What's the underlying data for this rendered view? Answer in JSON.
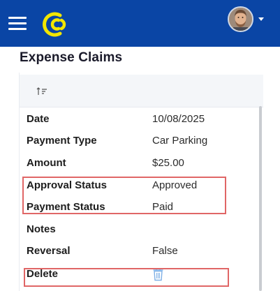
{
  "header": {
    "menu_icon": "hamburger-menu-icon",
    "logo_icon": "company-logo-icon",
    "avatar_icon": "user-avatar",
    "accent_color": "#0a45a5",
    "logo_color": "#f2e600"
  },
  "page": {
    "title": "Expense Claims"
  },
  "toolbar": {
    "sort_icon": "sort-ascending-icon"
  },
  "details": {
    "date": {
      "label": "Date",
      "value": "10/08/2025"
    },
    "payment_type": {
      "label": "Payment Type",
      "value": "Car Parking"
    },
    "amount": {
      "label": "Amount",
      "value": "$25.00"
    },
    "approval_status": {
      "label": "Approval Status",
      "value": "Approved"
    },
    "payment_status": {
      "label": "Payment Status",
      "value": "Paid"
    },
    "notes": {
      "label": "Notes",
      "value": ""
    },
    "reversal": {
      "label": "Reversal",
      "value": "False"
    },
    "delete": {
      "label": "Delete",
      "icon": "trash-icon"
    }
  },
  "annotations": {
    "highlight_color": "#e06666"
  }
}
